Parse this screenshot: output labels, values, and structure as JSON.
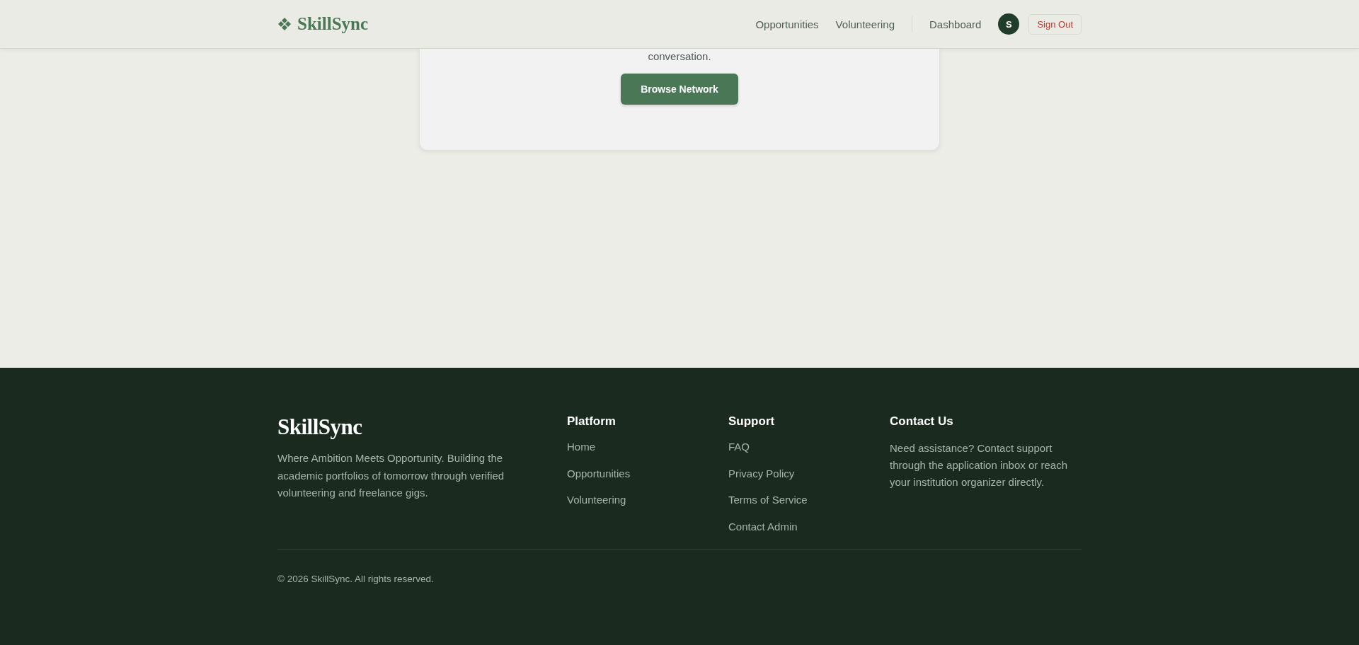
{
  "header": {
    "logo": "SkillSync",
    "nav": [
      {
        "label": "Opportunities"
      },
      {
        "label": "Volunteering"
      },
      {
        "label": "Dashboard"
      }
    ],
    "avatar": "S",
    "sign_out": "Sign Out"
  },
  "card": {
    "text": "conversation.",
    "button": "Browse Network"
  },
  "footer": {
    "brand": "SkillSync",
    "tagline": "Where Ambition Meets Opportunity. Building the academic portfolios of tomorrow through verified volunteering and freelance gigs.",
    "columns": [
      {
        "title": "Platform",
        "links": [
          "Home",
          "Opportunities",
          "Volunteering"
        ]
      },
      {
        "title": "Support",
        "links": [
          "FAQ",
          "Privacy Policy",
          "Terms of Service",
          "Contact Admin"
        ]
      }
    ],
    "contact": {
      "title": "Contact Us",
      "text": "Need assistance? Contact support through the application inbox or reach your institution organizer directly."
    },
    "copyright": "© 2026 SkillSync. All rights reserved."
  }
}
